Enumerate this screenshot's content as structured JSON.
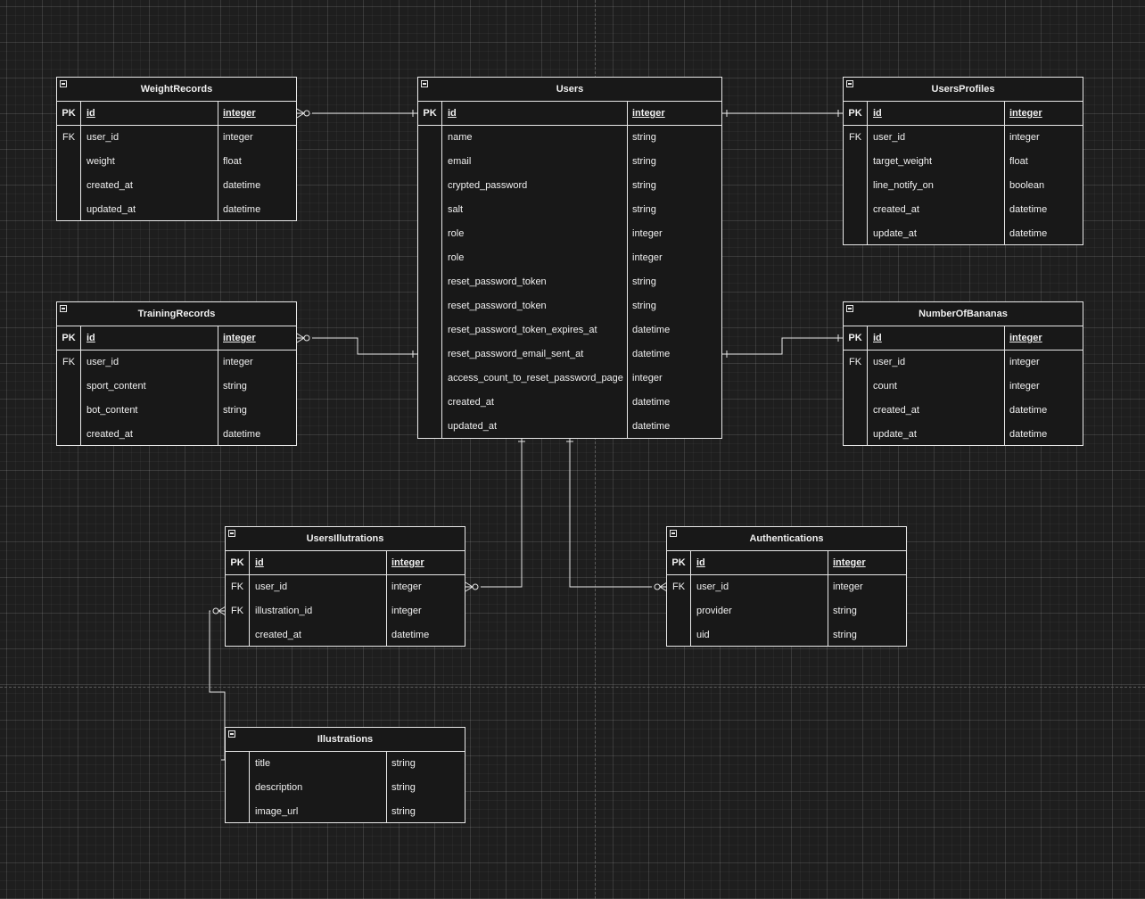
{
  "entities": {
    "weight_records": {
      "title": "WeightRecords",
      "pk": {
        "key": "PK",
        "name": "id",
        "type": "integer"
      },
      "rows": [
        {
          "key": "FK",
          "name": "user_id",
          "type": "integer"
        },
        {
          "key": "",
          "name": "weight",
          "type": "float"
        },
        {
          "key": "",
          "name": "created_at",
          "type": "datetime"
        },
        {
          "key": "",
          "name": "updated_at",
          "type": "datetime"
        }
      ]
    },
    "users": {
      "title": "Users",
      "pk": {
        "key": "PK",
        "name": "id",
        "type": "integer"
      },
      "rows": [
        {
          "key": "",
          "name": "name",
          "type": "string"
        },
        {
          "key": "",
          "name": "email",
          "type": "string"
        },
        {
          "key": "",
          "name": "crypted_password",
          "type": "string"
        },
        {
          "key": "",
          "name": "salt",
          "type": "string"
        },
        {
          "key": "",
          "name": "role",
          "type": "integer"
        },
        {
          "key": "",
          "name": "role",
          "type": "integer"
        },
        {
          "key": "",
          "name": "reset_password_token",
          "type": "string"
        },
        {
          "key": "",
          "name": "reset_password_token",
          "type": "string"
        },
        {
          "key": "",
          "name": "reset_password_token_expires_at",
          "type": "datetime"
        },
        {
          "key": "",
          "name": "reset_password_email_sent_at",
          "type": "datetime"
        },
        {
          "key": "",
          "name": "access_count_to_reset_password_page",
          "type": "integer"
        },
        {
          "key": "",
          "name": "created_at",
          "type": "datetime"
        },
        {
          "key": "",
          "name": "updated_at",
          "type": "datetime"
        }
      ]
    },
    "users_profiles": {
      "title": "UsersProfiles",
      "pk": {
        "key": "PK",
        "name": "id",
        "type": "integer"
      },
      "rows": [
        {
          "key": "FK",
          "name": "user_id",
          "type": "integer"
        },
        {
          "key": "",
          "name": "target_weight",
          "type": "float"
        },
        {
          "key": "",
          "name": "line_notify_on",
          "type": "boolean"
        },
        {
          "key": "",
          "name": "created_at",
          "type": "datetime"
        },
        {
          "key": "",
          "name": "update_at",
          "type": "datetime"
        }
      ]
    },
    "training_records": {
      "title": "TrainingRecords",
      "pk": {
        "key": "PK",
        "name": "id",
        "type": "integer"
      },
      "rows": [
        {
          "key": "FK",
          "name": "user_id",
          "type": "integer"
        },
        {
          "key": "",
          "name": "sport_content",
          "type": "string"
        },
        {
          "key": "",
          "name": "bot_content",
          "type": "string"
        },
        {
          "key": "",
          "name": "created_at",
          "type": "datetime"
        }
      ]
    },
    "number_of_bananas": {
      "title": "NumberOfBananas",
      "pk": {
        "key": "PK",
        "name": "id",
        "type": "integer"
      },
      "rows": [
        {
          "key": "FK",
          "name": "user_id",
          "type": "integer"
        },
        {
          "key": "",
          "name": "count",
          "type": "integer"
        },
        {
          "key": "",
          "name": "created_at",
          "type": "datetime"
        },
        {
          "key": "",
          "name": "update_at",
          "type": "datetime"
        }
      ]
    },
    "users_illutrations": {
      "title": "UsersIllutrations",
      "pk": {
        "key": "PK",
        "name": "id",
        "type": "integer"
      },
      "rows": [
        {
          "key": "FK",
          "name": "user_id",
          "type": "integer"
        },
        {
          "key": "FK",
          "name": "illustration_id",
          "type": "integer"
        },
        {
          "key": "",
          "name": "created_at",
          "type": "datetime"
        }
      ]
    },
    "authentications": {
      "title": "Authentications",
      "pk": {
        "key": "PK",
        "name": "id",
        "type": "integer"
      },
      "rows": [
        {
          "key": "FK",
          "name": "user_id",
          "type": "integer"
        },
        {
          "key": "",
          "name": "provider",
          "type": "string"
        },
        {
          "key": "",
          "name": "uid",
          "type": "string"
        }
      ]
    },
    "illustrations": {
      "title": "Illustrations",
      "rows": [
        {
          "key": "",
          "name": "title",
          "type": "string"
        },
        {
          "key": "",
          "name": "description",
          "type": "string"
        },
        {
          "key": "",
          "name": "image_url",
          "type": "string"
        }
      ]
    }
  },
  "relationships": [
    {
      "from": "Users",
      "to": "WeightRecords",
      "from_card": "one",
      "to_card": "zero-or-many"
    },
    {
      "from": "Users",
      "to": "UsersProfiles",
      "from_card": "one",
      "to_card": "one"
    },
    {
      "from": "Users",
      "to": "TrainingRecords",
      "from_card": "one",
      "to_card": "zero-or-many"
    },
    {
      "from": "Users",
      "to": "NumberOfBananas",
      "from_card": "one",
      "to_card": "one"
    },
    {
      "from": "Users",
      "to": "UsersIllutrations",
      "from_card": "one",
      "to_card": "zero-or-many"
    },
    {
      "from": "Users",
      "to": "Authentications",
      "from_card": "one",
      "to_card": "zero-or-many"
    },
    {
      "from": "Illustrations",
      "to": "UsersIllutrations",
      "from_card": "one",
      "to_card": "zero-or-many"
    }
  ],
  "colors": {
    "background": "#1e1e1e",
    "entity_fill": "#181818",
    "stroke": "#e8e8e8",
    "text": "#f0f0f0"
  }
}
